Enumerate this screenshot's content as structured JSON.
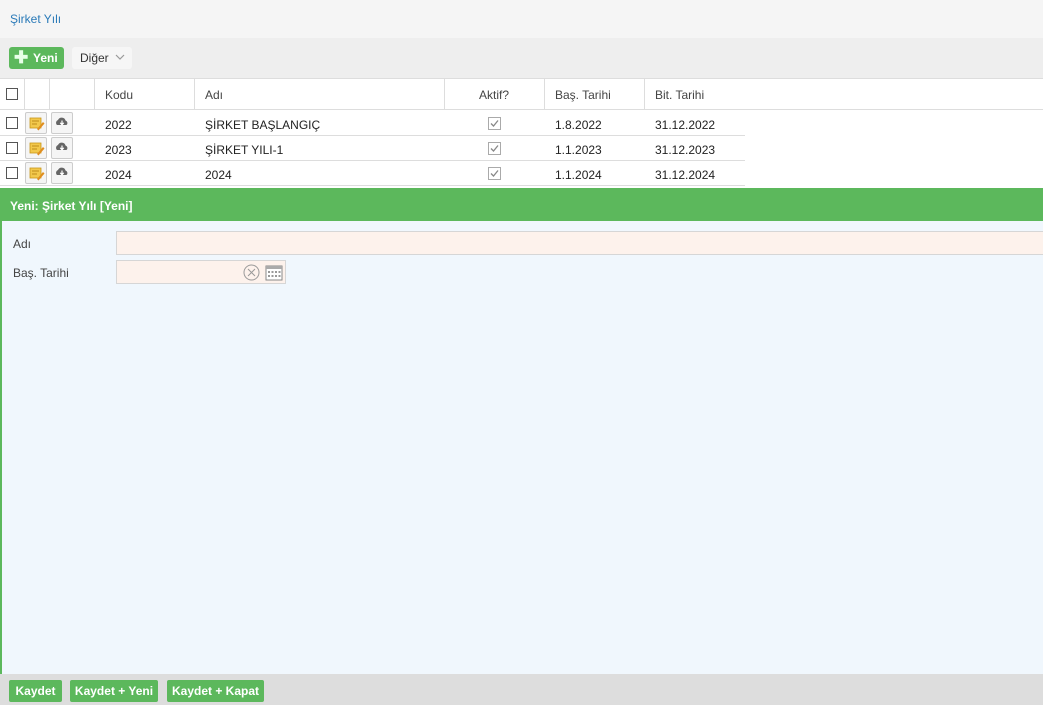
{
  "breadcrumb": "Şirket Yılı",
  "toolbar": {
    "new_label": "Yeni",
    "other_label": "Diğer"
  },
  "grid": {
    "headers": {
      "code": "Kodu",
      "name": "Adı",
      "active": "Aktif?",
      "start": "Baş. Tarihi",
      "end": "Bit. Tarihi"
    },
    "rows": [
      {
        "code": "2022",
        "name": "ŞİRKET BAŞLANGIÇ",
        "active": true,
        "start": "1.8.2022",
        "end": "31.12.2022"
      },
      {
        "code": "2023",
        "name": "ŞİRKET YILI-1",
        "active": true,
        "start": "1.1.2023",
        "end": "31.12.2023"
      },
      {
        "code": "2024",
        "name": "2024",
        "active": true,
        "start": "1.1.2024",
        "end": "31.12.2024"
      }
    ]
  },
  "form": {
    "title": "Yeni: Şirket Yılı [Yeni]",
    "name_label": "Adı",
    "name_value": "",
    "start_label": "Baş. Tarihi",
    "start_value": ""
  },
  "footer": {
    "save": "Kaydet",
    "save_new": "Kaydet + Yeni",
    "save_close": "Kaydet + Kapat"
  },
  "colors": {
    "accent": "#5cb85c",
    "link": "#2a7ab8",
    "form_bg": "#f0f7fd",
    "field_bg": "#fdf2ec"
  }
}
